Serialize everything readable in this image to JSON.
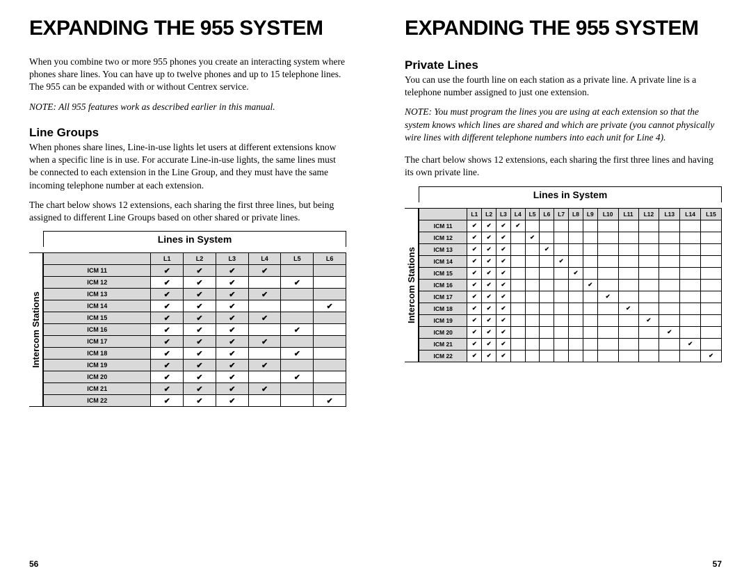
{
  "left": {
    "title": "EXPANDING THE 955 SYSTEM",
    "intro": "When you combine two or more 955 phones you create an interacting system where phones share lines. You can have up to twelve phones and up to 15 telephone lines. The 955 can be expanded with or without Centrex service.",
    "note": "NOTE:  All 955 features work as described earlier in this manual.",
    "heading": "Line Groups",
    "p1": "When phones share lines, Line-in-use lights let users at different extensions know when a specific line is in use. For accurate Line-in-use lights, the same lines must be connected to each extension in the Line Group, and they must have the same incoming telephone number at each extension.",
    "p2": "The chart below shows 12 extensions, each sharing the first three lines, but being assigned to different Line Groups based on other shared or private lines.",
    "table_caption": "Lines in System",
    "vlabel": "Intercom Stations",
    "pagenum": "56"
  },
  "right": {
    "title": "EXPANDING THE 955 SYSTEM",
    "heading": "Private Lines",
    "p1": "You can use the fourth line on each station as a private line. A private line is a telephone number assigned to just one extension.",
    "note": "NOTE:  You must program the lines you are using at each extension so that the system knows which lines are shared and which are private (you cannot physically wire lines with different telephone numbers into each unit for Line 4).",
    "p2": "The chart below shows 12 extensions, each sharing the first three lines and having its own private line.",
    "table_caption": "Lines in System",
    "vlabel": "Intercom Stations",
    "pagenum": "57"
  },
  "chart_data": [
    {
      "type": "table",
      "title": "Lines in System — Line Groups (p.56)",
      "columns": [
        "L1",
        "L2",
        "L3",
        "L4",
        "L5",
        "L6"
      ],
      "rows": [
        {
          "label": "ICM 11",
          "checks": [
            1,
            1,
            1,
            1,
            0,
            0
          ]
        },
        {
          "label": "ICM 12",
          "checks": [
            1,
            1,
            1,
            0,
            1,
            0
          ]
        },
        {
          "label": "ICM 13",
          "checks": [
            1,
            1,
            1,
            1,
            0,
            0
          ]
        },
        {
          "label": "ICM 14",
          "checks": [
            1,
            1,
            1,
            0,
            0,
            1
          ]
        },
        {
          "label": "ICM 15",
          "checks": [
            1,
            1,
            1,
            1,
            0,
            0
          ]
        },
        {
          "label": "ICM 16",
          "checks": [
            1,
            1,
            1,
            0,
            1,
            0
          ]
        },
        {
          "label": "ICM 17",
          "checks": [
            1,
            1,
            1,
            1,
            0,
            0
          ]
        },
        {
          "label": "ICM 18",
          "checks": [
            1,
            1,
            1,
            0,
            1,
            0
          ]
        },
        {
          "label": "ICM 19",
          "checks": [
            1,
            1,
            1,
            1,
            0,
            0
          ]
        },
        {
          "label": "ICM 20",
          "checks": [
            1,
            1,
            1,
            0,
            1,
            0
          ]
        },
        {
          "label": "ICM 21",
          "checks": [
            1,
            1,
            1,
            1,
            0,
            0
          ]
        },
        {
          "label": "ICM 22",
          "checks": [
            1,
            1,
            1,
            0,
            0,
            1
          ]
        }
      ]
    },
    {
      "type": "table",
      "title": "Lines in System — Private Lines (p.57)",
      "columns": [
        "L1",
        "L2",
        "L3",
        "L4",
        "L5",
        "L6",
        "L7",
        "L8",
        "L9",
        "L10",
        "L11",
        "L12",
        "L13",
        "L14",
        "L15"
      ],
      "rows": [
        {
          "label": "ICM 11",
          "checks": [
            1,
            1,
            1,
            1,
            0,
            0,
            0,
            0,
            0,
            0,
            0,
            0,
            0,
            0,
            0
          ]
        },
        {
          "label": "ICM 12",
          "checks": [
            1,
            1,
            1,
            0,
            1,
            0,
            0,
            0,
            0,
            0,
            0,
            0,
            0,
            0,
            0
          ]
        },
        {
          "label": "ICM 13",
          "checks": [
            1,
            1,
            1,
            0,
            0,
            1,
            0,
            0,
            0,
            0,
            0,
            0,
            0,
            0,
            0
          ]
        },
        {
          "label": "ICM 14",
          "checks": [
            1,
            1,
            1,
            0,
            0,
            0,
            1,
            0,
            0,
            0,
            0,
            0,
            0,
            0,
            0
          ]
        },
        {
          "label": "ICM 15",
          "checks": [
            1,
            1,
            1,
            0,
            0,
            0,
            0,
            1,
            0,
            0,
            0,
            0,
            0,
            0,
            0
          ]
        },
        {
          "label": "ICM 16",
          "checks": [
            1,
            1,
            1,
            0,
            0,
            0,
            0,
            0,
            1,
            0,
            0,
            0,
            0,
            0,
            0
          ]
        },
        {
          "label": "ICM 17",
          "checks": [
            1,
            1,
            1,
            0,
            0,
            0,
            0,
            0,
            0,
            1,
            0,
            0,
            0,
            0,
            0
          ]
        },
        {
          "label": "ICM 18",
          "checks": [
            1,
            1,
            1,
            0,
            0,
            0,
            0,
            0,
            0,
            0,
            1,
            0,
            0,
            0,
            0
          ]
        },
        {
          "label": "ICM 19",
          "checks": [
            1,
            1,
            1,
            0,
            0,
            0,
            0,
            0,
            0,
            0,
            0,
            1,
            0,
            0,
            0
          ]
        },
        {
          "label": "ICM 20",
          "checks": [
            1,
            1,
            1,
            0,
            0,
            0,
            0,
            0,
            0,
            0,
            0,
            0,
            1,
            0,
            0
          ]
        },
        {
          "label": "ICM 21",
          "checks": [
            1,
            1,
            1,
            0,
            0,
            0,
            0,
            0,
            0,
            0,
            0,
            0,
            0,
            1,
            0
          ]
        },
        {
          "label": "ICM 22",
          "checks": [
            1,
            1,
            1,
            0,
            0,
            0,
            0,
            0,
            0,
            0,
            0,
            0,
            0,
            0,
            1
          ]
        }
      ]
    }
  ],
  "checkmark": "✔"
}
